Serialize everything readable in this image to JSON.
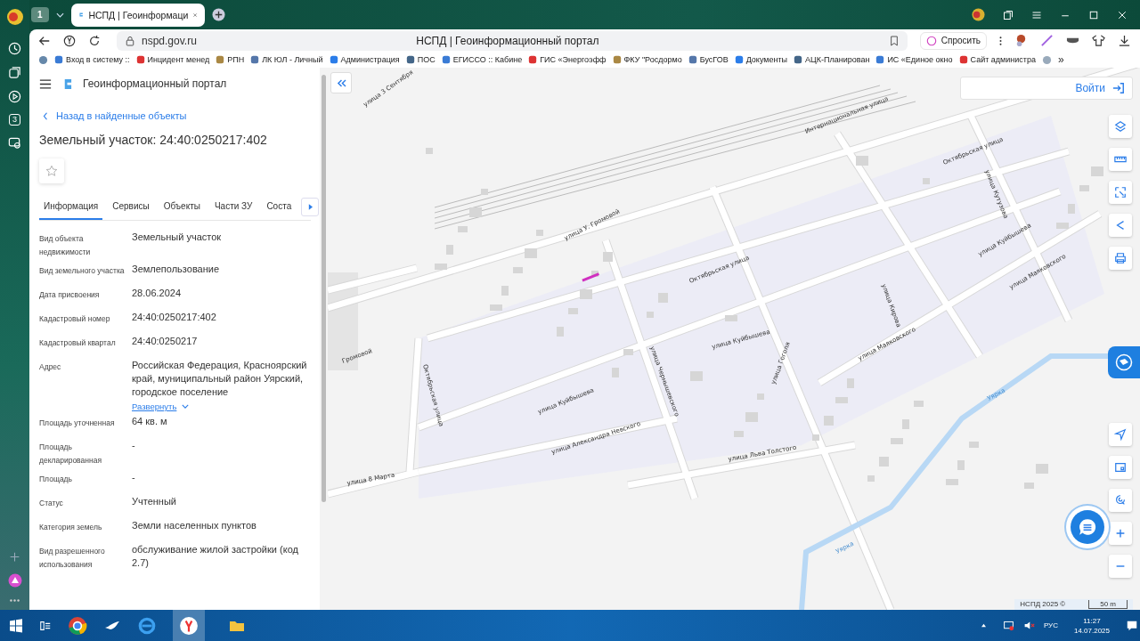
{
  "browser": {
    "tab_count": "1",
    "tab_title": "НСПД | Геоинформаци",
    "address": "nspd.gov.ru",
    "page_title": "НСПД | Геоинформационный портал",
    "ask_button": "Спросить",
    "bookmarks": [
      "Вход в систему ::",
      "Инцидент менед",
      "РПН",
      "ЛК ЮЛ - Личный",
      "Администрация",
      "ПОС",
      "ЕГИССО :: Кабине",
      "ГИС «Энергоэфф",
      "ФКУ \"Росдормо",
      "БусГОВ",
      "Документы",
      "АЦК-Планирован",
      "ИС «Единое окно",
      "Сайт администра"
    ],
    "more": "»",
    "side_badge": "3"
  },
  "panel": {
    "app_title": "Геоинформационный портал",
    "back_link": "Назад в найденные объекты",
    "heading": "Земельный участок: 24:40:0250217:402",
    "tabs": [
      {
        "label": "Информация",
        "selected": true
      },
      {
        "label": "Сервисы",
        "selected": false
      },
      {
        "label": "Объекты",
        "selected": false
      },
      {
        "label": "Части ЗУ",
        "selected": false
      },
      {
        "label": "Соста",
        "selected": false
      }
    ],
    "fields": [
      {
        "label": "Вид объекта недвижимости",
        "value": "Земельный участок"
      },
      {
        "label": "Вид земельного участка",
        "value": "Землепользование"
      },
      {
        "label": "Дата присвоения",
        "value": "28.06.2024"
      },
      {
        "label": "Кадастровый номер",
        "value": "24:40:0250217:402"
      },
      {
        "label": "Кадастровый квартал",
        "value": "24:40:0250217"
      },
      {
        "label": "Адрес",
        "value": "Российская Федерация, Красноярский край, муниципальный район Уярский, городское поселение",
        "expand": "Развернуть"
      },
      {
        "label": "Площадь уточненная",
        "value": "64 кв. м"
      },
      {
        "label": "Площадь декларированная",
        "value": "-"
      },
      {
        "label": "Площадь",
        "value": "-"
      },
      {
        "label": "Статус",
        "value": "Учтенный"
      },
      {
        "label": "Категория земель",
        "value": "Земли населенных пунктов"
      },
      {
        "label": "Вид разрешенного использования",
        "value": "обслуживание жилой застройки (код 2.7)"
      }
    ]
  },
  "map": {
    "login": "Войти",
    "street_labels": [
      "улица 3 Сентября",
      "Интернациональная улица",
      "Октябрьская улица",
      "улица Кутузова",
      "улица Куйбышева",
      "улица Маяковского",
      "улица У. Громовой",
      "Октябрьская улица",
      "улица Кирова",
      "улица Чернышевского",
      "улица Куйбышева",
      "улица Гоголя",
      "улица Маяковского",
      "Громовой",
      "Октябрьская улица",
      "улица Куйбышева",
      "улица Александра Невского",
      "улица Льва Толстого",
      "улица 8 Марта"
    ],
    "river_labels": [
      "Уярка",
      "Уярка"
    ],
    "copyright": "НСПД 2025 ©",
    "scale": "50 m"
  },
  "taskbar": {
    "lang": "РУС",
    "time": "11:27",
    "date": "14.07.2025"
  }
}
